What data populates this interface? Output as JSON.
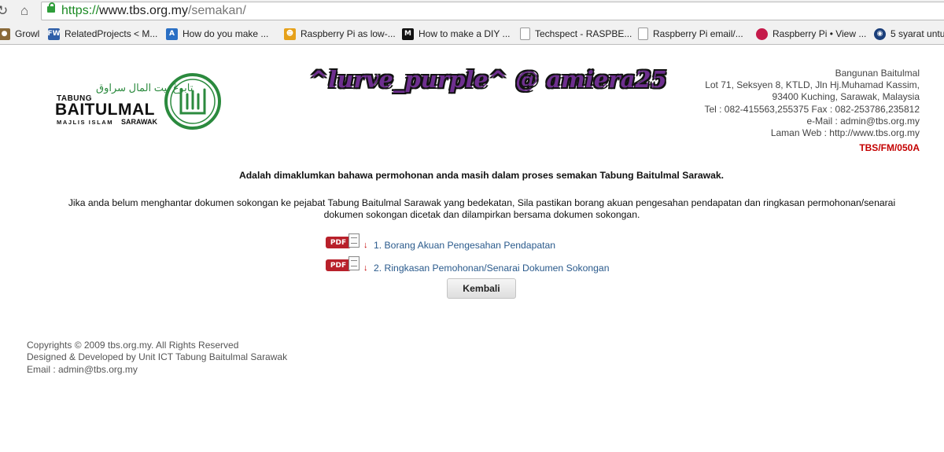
{
  "browser": {
    "url": {
      "protocol": "https://",
      "host": "www.tbs.org.my",
      "path": "/semakan/"
    },
    "bookmarks": [
      {
        "label": "Growl",
        "icon": "growl-icon",
        "color": "#8a6a3a",
        "glyph": "●"
      },
      {
        "label": "RelatedProjects < M...",
        "icon": "fw-icon",
        "color": "#2f5fa8",
        "glyph": "FW"
      },
      {
        "label": "How do you make ...",
        "icon": "ask-icon",
        "color": "#2a6fc4",
        "glyph": "A"
      },
      {
        "label": "Raspberry Pi as low-...",
        "icon": "instructables-icon",
        "color": "#e6a11a",
        "glyph": "☻"
      },
      {
        "label": "How to make a DIY ...",
        "icon": "medium-icon",
        "color": "#111111",
        "glyph": "M"
      },
      {
        "label": "Techspect - RASPBE...",
        "icon": "page-icon",
        "color": "#ffffff",
        "glyph": ""
      },
      {
        "label": "Raspberry Pi email/...",
        "icon": "page-icon",
        "color": "#ffffff",
        "glyph": ""
      },
      {
        "label": "Raspberry Pi • View ...",
        "icon": "raspberry-icon",
        "color": "#c51a4a",
        "glyph": "●"
      },
      {
        "label": "5 syarat untu",
        "icon": "globe-icon",
        "color": "#1b3f7a",
        "glyph": "◉"
      }
    ]
  },
  "page": {
    "logo": {
      "tabung": "TABUNG",
      "arabic": "تابوڠ بيت المال سراوق",
      "main": "BAITULMAL",
      "sub": "MAJLIS ISLAM",
      "sub2": "SARAWAK"
    },
    "overlay_text": "^lurve_purple^ @ amiera25",
    "address": {
      "lines": [
        "Bangunan Baitulmal",
        "Lot 71, Seksyen 8, KTLD, Jln Hj.Muhamad Kassim,",
        "93400 Kuching, Sarawak, Malaysia",
        "Tel : 082-415563,255375 Fax : 082-253786,235812",
        "e-Mail : admin@tbs.org.my",
        "Laman Web : http://www.tbs.org.my"
      ],
      "form_code": "TBS/FM/050A"
    },
    "notice": "Adalah dimaklumkan bahawa permohonan anda masih dalam proses semakan Tabung Baitulmal Sarawak.",
    "info": "Jika anda belum menghantar dokumen sokongan ke pejabat Tabung Baitulmal Sarawak yang bedekatan, Sila pastikan borang akuan pengesahan pendapatan dan ringkasan permohonan/senarai dokumen sokongan dicetak dan dilampirkan bersama dokumen sokongan.",
    "pdf_badge": "PDF",
    "links": [
      "1. Borang Akuan Pengesahan Pendapatan",
      "2. Ringkasan Pemohonan/Senarai Dokumen Sokongan"
    ],
    "back_button": "Kembali"
  },
  "footer": {
    "copyright": "Copyrights © 2009 tbs.org.my. All Rights Reserved",
    "designed": "Designed & Developed by Unit ICT Tabung Baitulmal Sarawak",
    "email": "Email : admin@tbs.org.my"
  }
}
